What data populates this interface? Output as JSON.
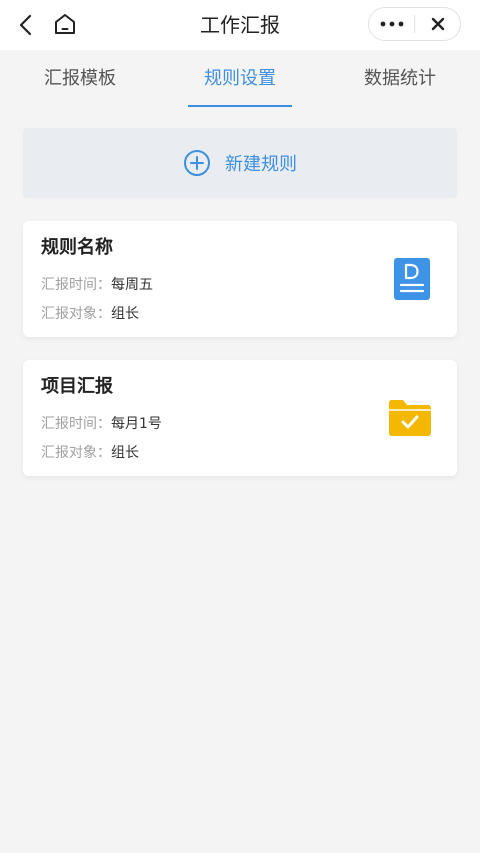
{
  "header": {
    "title": "工作汇报",
    "back_icon": "chevron-left-icon",
    "home_icon": "home-icon",
    "more_icon": "more-dots-icon",
    "close_icon": "close-icon"
  },
  "tabs": [
    {
      "label": "汇报模板",
      "active": false
    },
    {
      "label": "规则设置",
      "active": true
    },
    {
      "label": "数据统计",
      "active": false
    }
  ],
  "new_rule": {
    "label": "新建规则",
    "icon": "plus-circle-icon"
  },
  "cards": [
    {
      "title": "规则名称",
      "time_label": "汇报时间：",
      "time_value": "每周五",
      "target_label": "汇报对象：",
      "target_value": "组长",
      "icon": "document-icon"
    },
    {
      "title": "项目汇报",
      "time_label": "汇报时间：",
      "time_value": "每月1号",
      "target_label": "汇报对象：",
      "target_value": "组长",
      "icon": "folder-check-icon"
    }
  ],
  "colors": {
    "accent": "#3d8fe0",
    "document_icon": "#3f93e6",
    "folder_icon": "#f5b800",
    "background": "#f4f4f5"
  }
}
